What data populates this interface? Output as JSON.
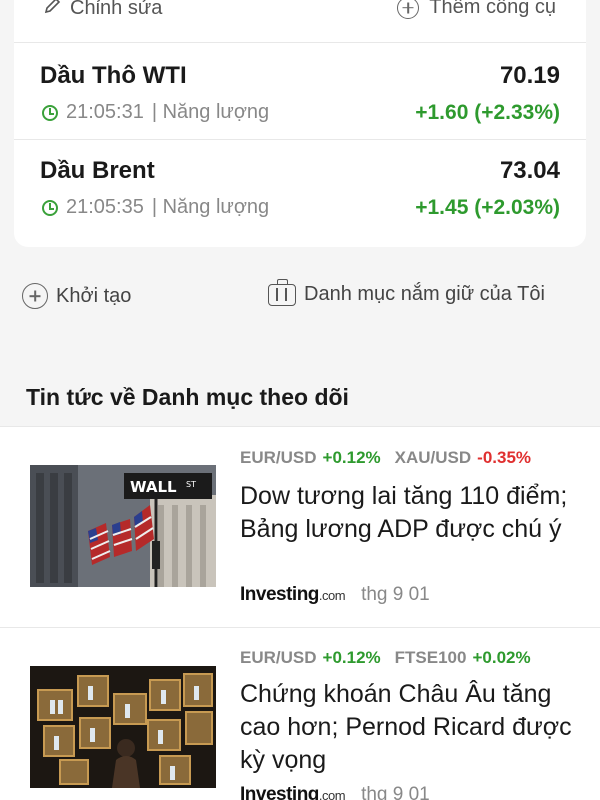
{
  "toolbar": {
    "edit_label": "Chỉnh sửa",
    "add_tool_label": "Thêm công cụ"
  },
  "quotes": [
    {
      "name": "Dầu Thô WTI",
      "price": "70.19",
      "time": "21:05:31",
      "category": "| Năng lượng",
      "change": "+1.60 (+2.33%)"
    },
    {
      "name": "Dầu Brent",
      "price": "73.04",
      "time": "21:05:35",
      "category": "| Năng lượng",
      "change": "+1.45 (+2.03%)"
    }
  ],
  "actions": {
    "create_label": "Khởi tạo",
    "portfolio_label": "Danh mục nắm giữ của Tôi"
  },
  "news_section": {
    "title": "Tin tức về Danh mục theo dõi"
  },
  "news": [
    {
      "tags": [
        {
          "symbol": "EUR/USD",
          "change": "+0.12%"
        },
        {
          "symbol": "XAU/USD",
          "change": "-0.35%"
        }
      ],
      "headline": "Dow tương lai tăng 110 điểm; Bảng lương ADP được chú ý",
      "source_main": "Investing",
      "source_suffix": ".com",
      "date": "thg 9 01",
      "thumb_sign": "WALL ST"
    },
    {
      "tags": [
        {
          "symbol": "EUR/USD",
          "change": "+0.12%"
        },
        {
          "symbol": "FTSE100",
          "change": "+0.02%"
        }
      ],
      "headline": "Chứng khoán Châu Âu tăng cao hơn; Pernod Ricard được kỳ vọng",
      "source_main": "Investing",
      "source_suffix": ".com",
      "date": "thg 9 01"
    }
  ],
  "colors": {
    "positive": "#2e9a2e",
    "negative": "#e03030",
    "clock_icon": "#3aa13a"
  }
}
